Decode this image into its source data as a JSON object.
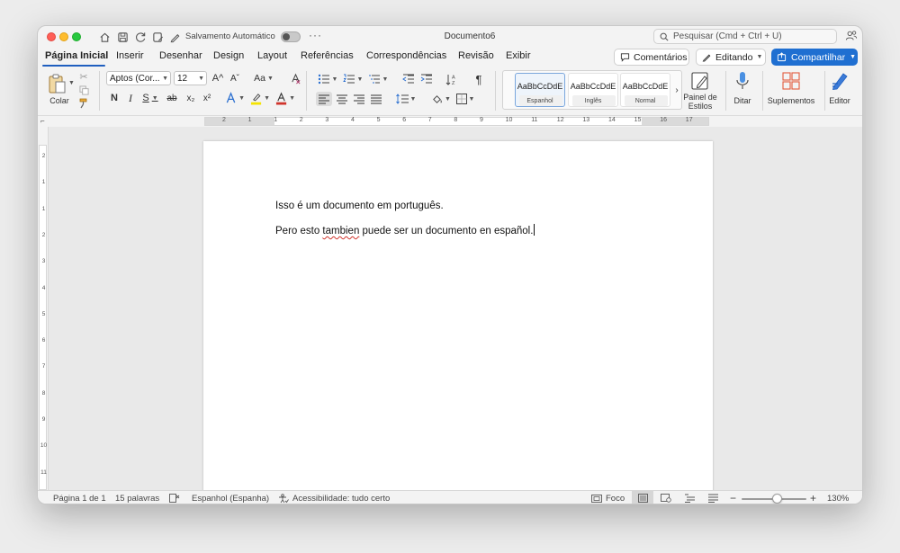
{
  "titlebar": {
    "autosave_label": "Salvamento Automático",
    "more": "···",
    "doc_title": "Documento6",
    "search_placeholder": "Pesquisar (Cmd + Ctrl + U)"
  },
  "tabs": [
    "Página Inicial",
    "Inserir",
    "Desenhar",
    "Design",
    "Layout",
    "Referências",
    "Correspondências",
    "Revisão",
    "Exibir"
  ],
  "tab_active": "Página Inicial",
  "actions": {
    "comments": "Comentários",
    "editing": "Editando",
    "share": "Compartilhar"
  },
  "ribbon": {
    "paste_label": "Colar",
    "font_name": "Aptos (Cor...",
    "font_size": "12",
    "grow_font": "A^",
    "shrink_font": "Aˇ",
    "change_case": "Aa",
    "bold": "N",
    "italic": "I",
    "underline": "S",
    "strike": "ab",
    "subscript": "x₂",
    "superscript": "x²",
    "styles": [
      {
        "sample": "AaBbCcDdE",
        "name": "Espanhol",
        "selected": true
      },
      {
        "sample": "AaBbCcDdE",
        "name": "Inglês",
        "selected": false
      },
      {
        "sample": "AaBbCcDdE",
        "name": "Normal",
        "selected": false
      }
    ],
    "styles_pane_label_1": "Painel de",
    "styles_pane_label_2": "Estilos",
    "dictate_label": "Ditar",
    "addins_label": "Suplementos",
    "editor_label": "Editor"
  },
  "ruler": {
    "numbers": [
      "2",
      "1",
      "1",
      "2",
      "3",
      "4",
      "5",
      "6",
      "7",
      "8",
      "9",
      "10",
      "11",
      "12",
      "13",
      "14",
      "15",
      "16",
      "17"
    ],
    "vertical_numbers": [
      "2",
      "1",
      "1",
      "2",
      "3",
      "4",
      "5",
      "6",
      "7",
      "8",
      "9",
      "10",
      "11"
    ]
  },
  "document": {
    "line1": "Isso é um documento em português.",
    "line2_a": "Pero esto ",
    "line2_misspelled": "tambien",
    "line2_b": " puede ser un documento en español."
  },
  "status": {
    "page": "Página 1 de 1",
    "words": "15 palavras",
    "language": "Espanhol (Espanha)",
    "accessibility": "Acessibilidade: tudo certo",
    "focus": "Foco",
    "zoom_out": "−",
    "zoom_in": "+",
    "zoom": "130%"
  },
  "colors": {
    "accent": "#1f6fd1",
    "highlight": "#f5e300",
    "font_color": "#d0342c",
    "spell_error": "#d0342c"
  }
}
